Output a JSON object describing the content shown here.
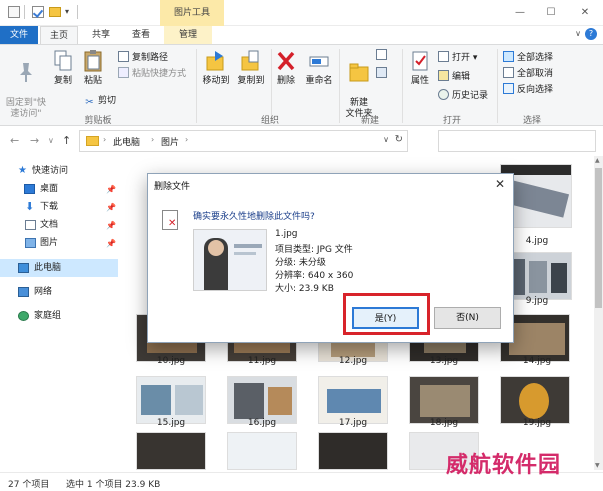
{
  "titlebar": {
    "context_title": "图片工具",
    "minimize": "—",
    "maximize": "☐",
    "close": "✕"
  },
  "tabs": {
    "file": "文件",
    "home": "主页",
    "share": "共享",
    "view": "查看",
    "manage": "管理",
    "collapse": "∨",
    "help": "?"
  },
  "ribbon": {
    "pin_quick_access": "固定到\"快\n速访问\"",
    "copy": "复制",
    "paste": "粘贴",
    "copy_path": "复制路径",
    "paste_shortcut": "粘贴快捷方式",
    "cut": "剪切",
    "clipboard_group": "剪贴板",
    "move_to": "移动到",
    "copy_to": "复制到",
    "delete": "删除",
    "rename": "重命名",
    "organize_group": "组织",
    "new_folder": "新建\n文件夹",
    "new_group": "新建",
    "properties": "属性",
    "open": "打开 ▾",
    "edit": "编辑",
    "history": "历史记录",
    "open_group": "打开",
    "select_all": "全部选择",
    "select_none": "全部取消",
    "invert_selection": "反向选择",
    "select_group": "选择"
  },
  "address": {
    "back": "←",
    "forward": "→",
    "history_down": "∨",
    "up": "↑",
    "crumb1": "此电脑",
    "crumb2": "图片",
    "sep": "›",
    "dropdown": "∨",
    "refresh": "↻"
  },
  "nav": {
    "quick_access": "快速访问",
    "desktop": "桌面",
    "downloads": "下载",
    "documents": "文档",
    "pictures": "图片",
    "this_pc": "此电脑",
    "network": "网络",
    "homegroup": "家庭组",
    "pin_glyph": "📌"
  },
  "files": {
    "names": [
      "4.jpg",
      "9.jpg",
      "10.jpg",
      "11.jpg",
      "12.jpg",
      "13.jpg",
      "14.jpg",
      "15.jpg",
      "16.jpg",
      "17.jpg",
      "18.jpg",
      "19.jpg"
    ]
  },
  "status": {
    "count": "27 个项目",
    "selected": "选中 1 个项目  23.9 KB"
  },
  "watermark": "威航软件园",
  "dialog": {
    "title": "删除文件",
    "close": "✕",
    "question": "确实要永久性地删除此文件吗?",
    "filename": "1.jpg",
    "type": "项目类型: JPG 文件",
    "rating": "分级: 未分级",
    "resolution": "分辨率: 640 x 360",
    "size": "大小: 23.9 KB",
    "yes": "是(Y)",
    "no": "否(N)"
  },
  "colors": {
    "accent": "#1f6fc6",
    "context_tab": "#fce9a8",
    "highlight_box": "#d8232a",
    "watermark": "#d42b6a"
  }
}
